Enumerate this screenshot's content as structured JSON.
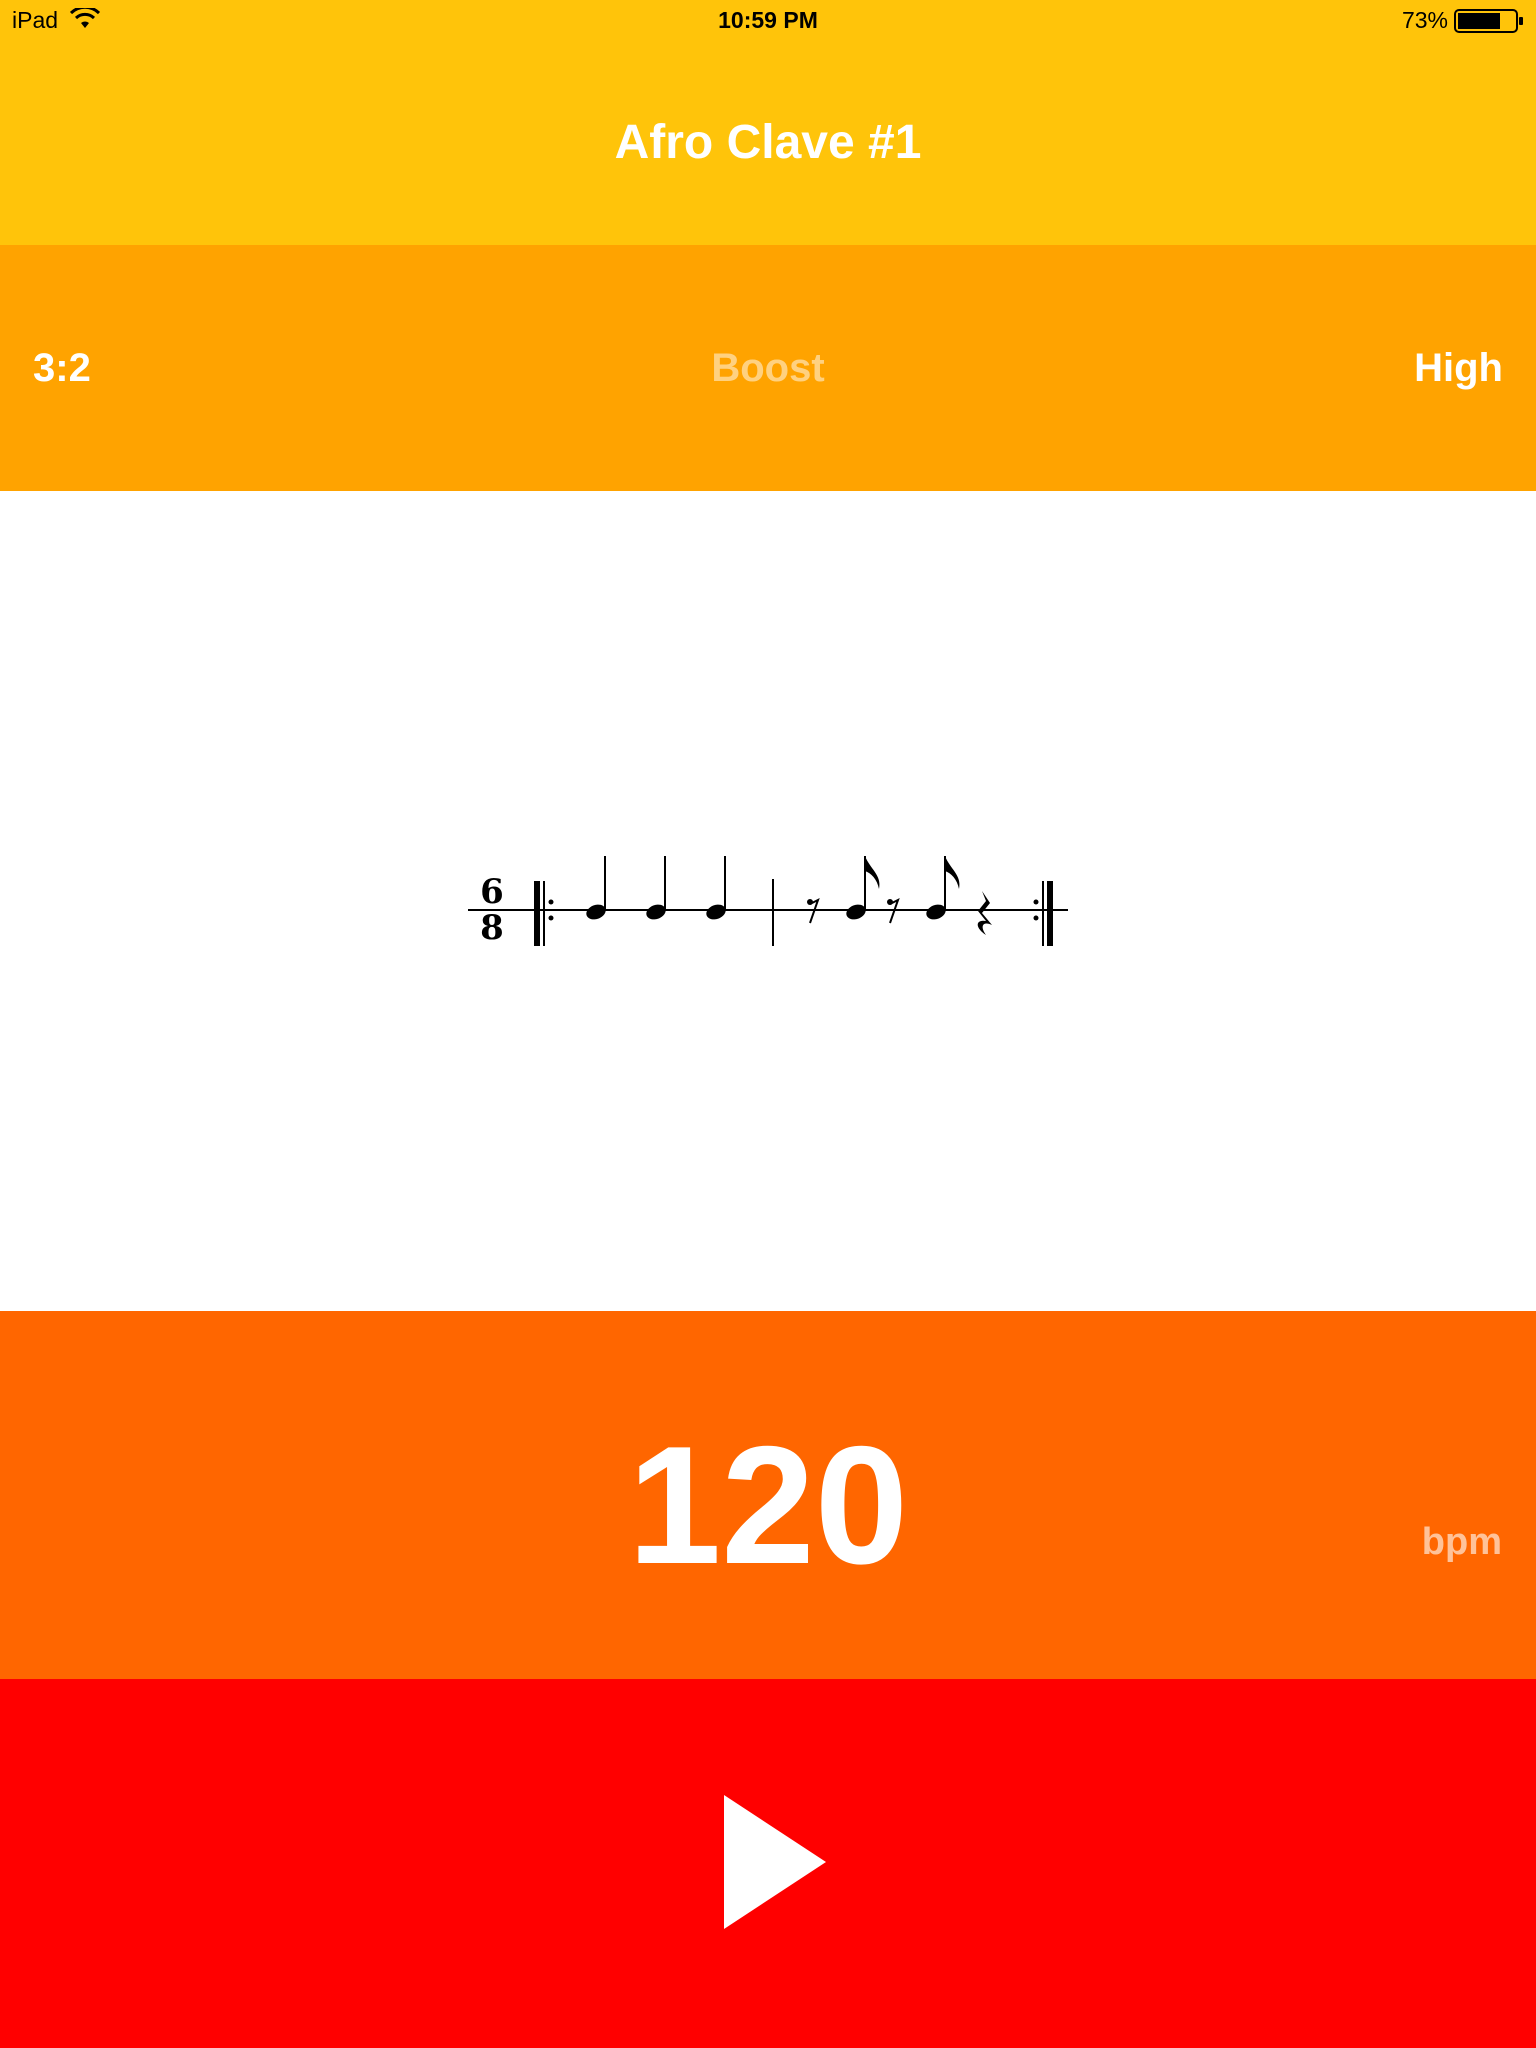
{
  "status_bar": {
    "device": "iPad",
    "time": "10:59 PM",
    "battery": "73%",
    "wifi_icon": "wifi-icon",
    "battery_icon": "battery-icon"
  },
  "header": {
    "title": "Afro Clave #1"
  },
  "options": {
    "left_label": "3:2",
    "center_label": "Boost",
    "right_label": "High"
  },
  "notation": {
    "time_signature_top": "6",
    "time_signature_bottom": "8"
  },
  "tempo": {
    "value": "120",
    "unit": "bpm"
  },
  "play": {
    "icon": "play-icon"
  },
  "colors": {
    "title_bg": "#FFC40A",
    "options_bg": "#FFA300",
    "tempo_bg": "#FF6600",
    "play_bg": "#FF0000"
  }
}
